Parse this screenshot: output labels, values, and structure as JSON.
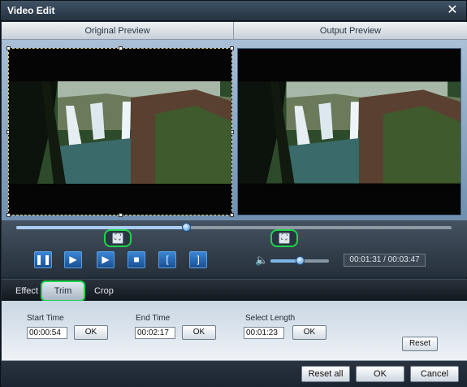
{
  "window": {
    "title": "Video Edit"
  },
  "preview": {
    "original_label": "Original Preview",
    "output_label": "Output Preview"
  },
  "playback": {
    "position_fraction": 0.39,
    "volume_fraction": 0.5,
    "time_display": "00:01:31 / 00:03:47"
  },
  "tabs": [
    {
      "label": "Effect"
    },
    {
      "label": "Trim"
    },
    {
      "label": "Crop"
    }
  ],
  "trim": {
    "start_label": "Start Time",
    "start_value": "00:00:54",
    "end_label": "End Time",
    "end_value": "00:02:17",
    "length_label": "Select Length",
    "length_value": "00:01:23",
    "ok_label": "OK",
    "reset_label": "Reset"
  },
  "footer": {
    "reset_all": "Reset all",
    "ok": "OK",
    "cancel": "Cancel"
  },
  "colors": {
    "accent": "#1fd34a",
    "button_blue": "#2b6fbf"
  }
}
